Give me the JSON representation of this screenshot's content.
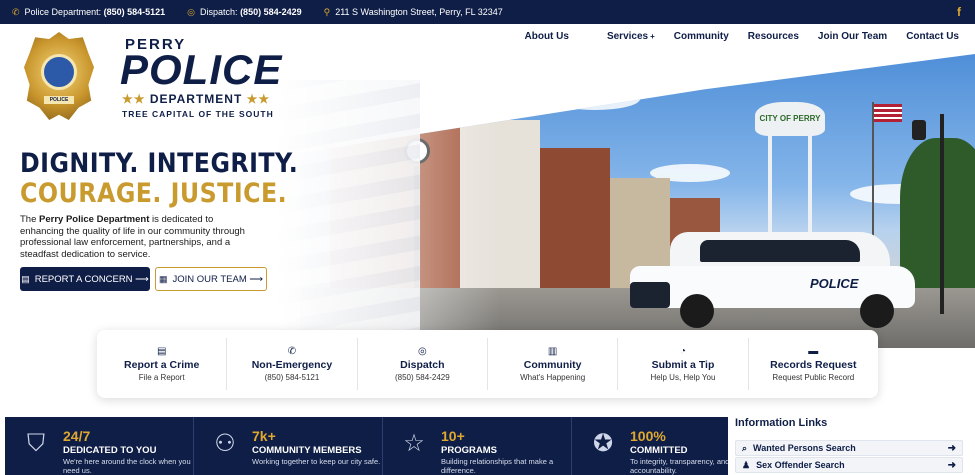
{
  "topbar": {
    "police_label": "Police Department:",
    "police_phone": "(850) 584-5121",
    "dispatch_label": "Dispatch:",
    "dispatch_phone": "(850) 584-2429",
    "address": "211 S Washington Street, Perry, FL 32347",
    "social_icon": "facebook-icon"
  },
  "nav": {
    "about": "About Us",
    "services": "Services",
    "services_mark": "+",
    "community": "Community",
    "resources": "Resources",
    "join": "Join Our Team",
    "contact": "Contact Us"
  },
  "logo": {
    "perry": "PERRY",
    "police": "POLICE",
    "department": "DEPARTMENT",
    "stars": "★★",
    "tagline": "TREE CAPITAL OF THE SOUTH",
    "badge_ribbon": "POLICE"
  },
  "hero": {
    "headline1": "DIGNITY. INTEGRITY.",
    "headline2": "COURAGE. JUSTICE.",
    "desc_pre": "The ",
    "desc_bold": "Perry Police Department",
    "desc_post": " is dedicated to enhancing the quality of life in our community through professional law enforcement, partnerships, and a steadfast dedication to service.",
    "report_button": "REPORT A CONCERN ⟶",
    "join_button": "JOIN OUR TEAM ⟶",
    "water_tower_text": "CITY OF PERRY"
  },
  "quick_links": [
    {
      "icon": "document-icon",
      "title": "Report a Crime",
      "sub": "File a Report"
    },
    {
      "icon": "phone-icon",
      "title": "Non-Emergency",
      "sub": "(850) 584-5121"
    },
    {
      "icon": "headset-icon",
      "title": "Dispatch",
      "sub": "(850) 584-2429"
    },
    {
      "icon": "newspaper-icon",
      "title": "Community",
      "sub": "What's Happening"
    },
    {
      "icon": "chat-icon",
      "title": "Submit a Tip",
      "sub": "Help Us, Help You"
    },
    {
      "icon": "folder-icon",
      "title": "Records Request",
      "sub": "Request Public Record"
    }
  ],
  "stats": [
    {
      "icon": "shield-star-icon",
      "value": "24/7",
      "label": "DEDICATED TO YOU",
      "desc": "We're here around the clock when you need us."
    },
    {
      "icon": "people-icon",
      "value": "7k+",
      "label": "COMMUNITY MEMBERS",
      "desc": "Working together to keep our city safe."
    },
    {
      "icon": "star-icon",
      "value": "10+",
      "label": "PROGRAMS",
      "desc": "Building relationships that make a difference."
    },
    {
      "icon": "check-badge-icon",
      "value": "100%",
      "label": "COMMITTED",
      "desc": "To integrity, transparency, and accountability."
    }
  ],
  "info_links": {
    "title": "Information Links",
    "items": [
      {
        "icon": "search-icon",
        "label": "Wanted Persons Search"
      },
      {
        "icon": "person-icon",
        "label": "Sex Offender Search"
      }
    ]
  },
  "colors": {
    "navy": "#0f1e47",
    "gold": "#c99a2e"
  }
}
